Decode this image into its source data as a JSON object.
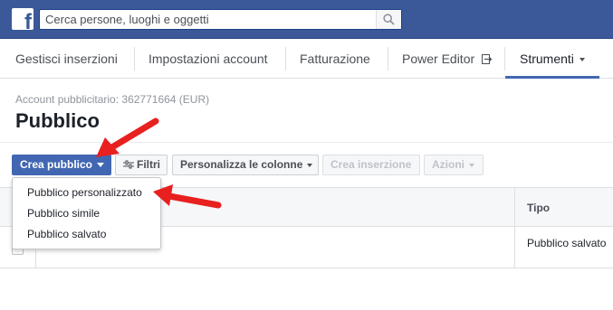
{
  "topbar": {
    "logo_letter": "f",
    "search_placeholder": "Cerca persone, luoghi e oggetti",
    "search_icon": "search-icon",
    "brand_color": "#3b5998"
  },
  "nav": {
    "items": [
      {
        "label": "Gestisci inserzioni"
      },
      {
        "label": "Impostazioni account"
      },
      {
        "label": "Fatturazione"
      },
      {
        "label": "Power Editor",
        "icon": "external-link-icon"
      },
      {
        "label": "Strumenti",
        "active": true,
        "icon": "chevron-down-icon"
      }
    ]
  },
  "page": {
    "account_line": "Account pubblicitario: 362771664 (EUR)",
    "title": "Pubblico"
  },
  "toolbar": {
    "create_label": "Crea pubblico",
    "filters_label": "Filtri",
    "customize_label": "Personalizza le colonne",
    "create_ad_label": "Crea inserzione",
    "actions_label": "Azioni",
    "accent_color": "#4267b2"
  },
  "menu": {
    "items": [
      {
        "label": "Pubblico personalizzato"
      },
      {
        "label": "Pubblico simile"
      },
      {
        "label": "Pubblico salvato"
      }
    ]
  },
  "table": {
    "headers": {
      "tipo": "Tipo"
    },
    "rows": [
      {
        "tipo": "Pubblico salvato"
      }
    ]
  },
  "annotation": {
    "arrow_color": "#e8201f"
  }
}
